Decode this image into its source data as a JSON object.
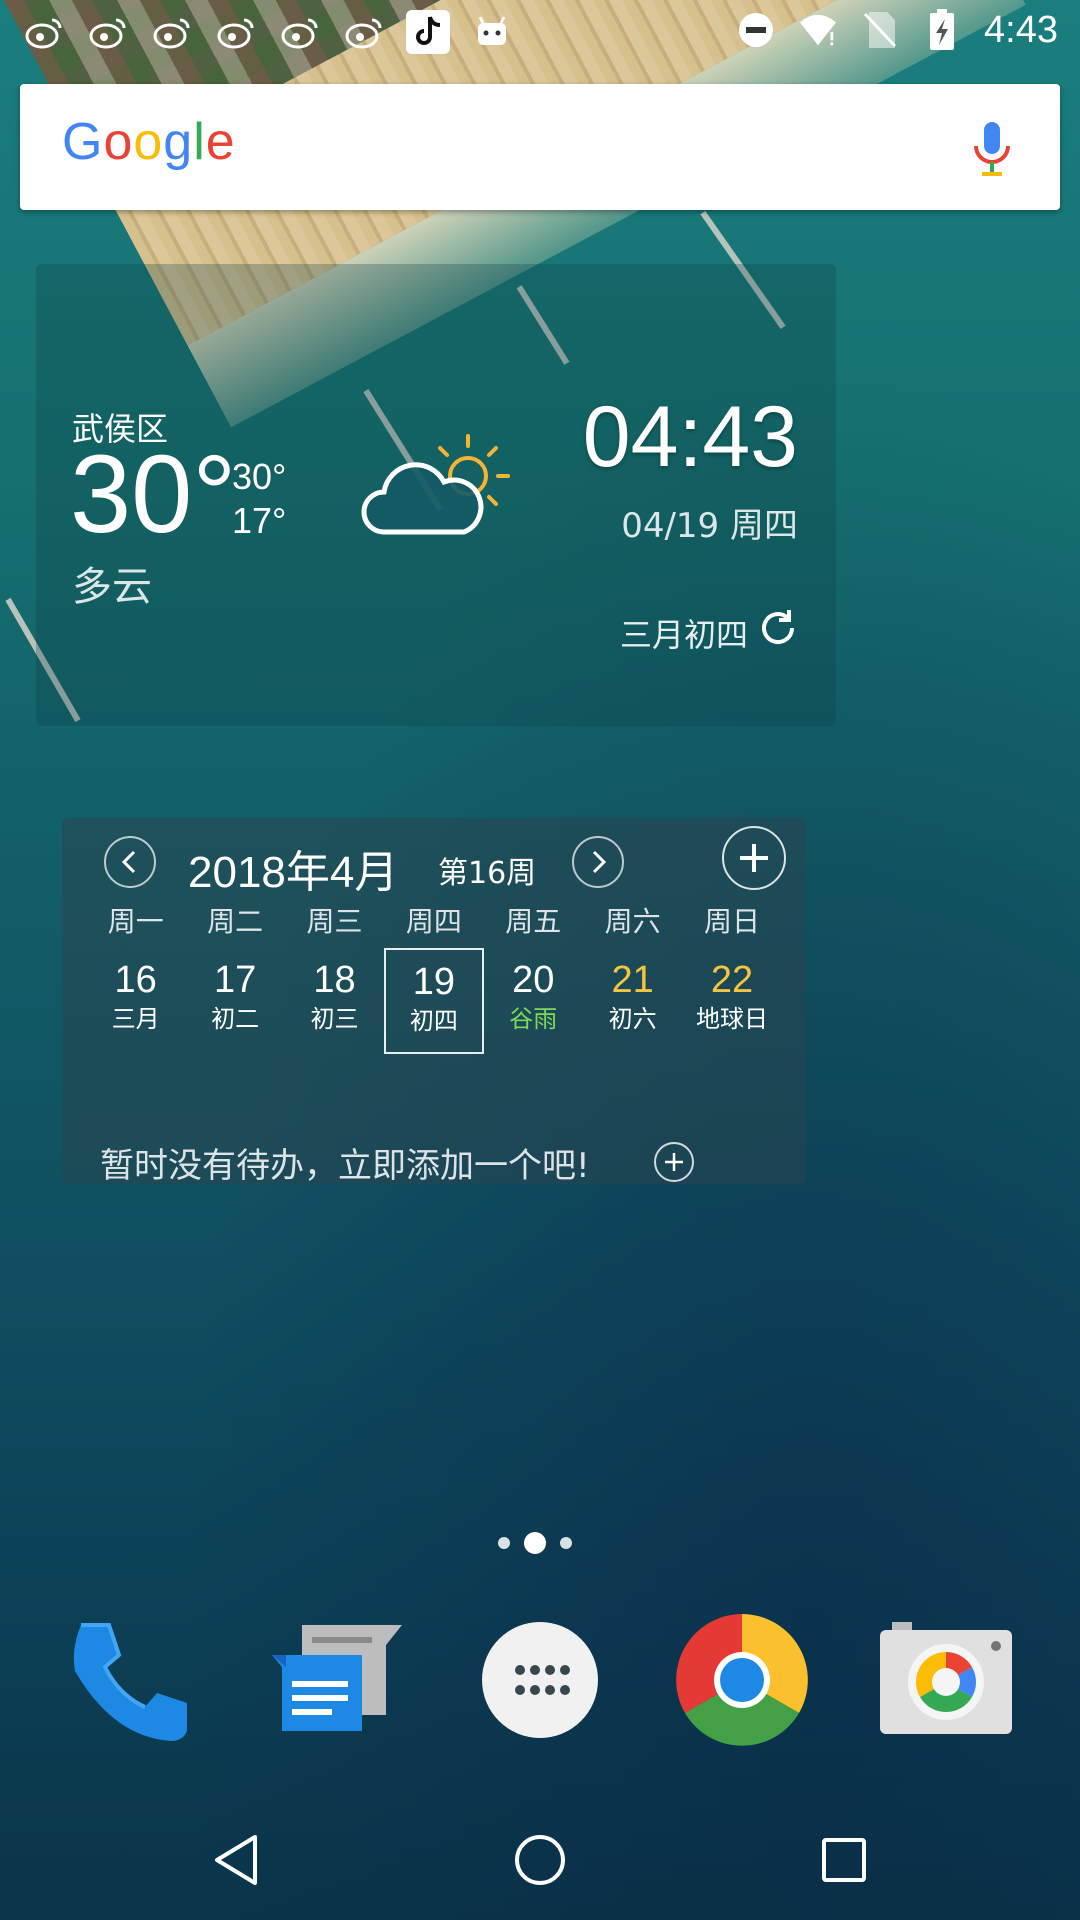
{
  "status_bar": {
    "notification_icons": [
      "weibo-icon",
      "weibo-icon",
      "weibo-icon",
      "weibo-icon",
      "weibo-icon",
      "weibo-icon",
      "douyin-icon",
      "android-icon"
    ],
    "system_icons": [
      "do-not-disturb-icon",
      "wifi-icon",
      "no-sim-icon",
      "battery-charging-icon"
    ],
    "time": "4:43"
  },
  "search": {
    "logo": "Google",
    "logo_colors": [
      "#4285F4",
      "#EA4335",
      "#FBBC05",
      "#4285F4",
      "#34A853",
      "#EA4335"
    ]
  },
  "weather": {
    "district": "武侯区",
    "temperature": "30°",
    "high": "30°",
    "low": "17°",
    "condition": "多云",
    "condition_icon": "partly-cloudy-icon",
    "time": "04:43",
    "date": "04/19  周四",
    "lunar_date": "三月初四"
  },
  "calendar": {
    "month_title": "2018年4月",
    "week_label": "第16周",
    "weekdays": [
      "周一",
      "周二",
      "周三",
      "周四",
      "周五",
      "周六",
      "周日"
    ],
    "days": [
      {
        "num": "16",
        "lunar": "三月"
      },
      {
        "num": "17",
        "lunar": "初二"
      },
      {
        "num": "18",
        "lunar": "初三"
      },
      {
        "num": "19",
        "lunar": "初四"
      },
      {
        "num": "20",
        "lunar": "谷雨"
      },
      {
        "num": "21",
        "lunar": "初六"
      },
      {
        "num": "22",
        "lunar": "地球日"
      }
    ],
    "selected_day": "19",
    "empty_message": "暂时没有待办，立即添加一个吧!",
    "weekend_color": "#F5C542",
    "solar_term_color": "#7ED957"
  },
  "home": {
    "page_count": 3,
    "active_page": 2
  },
  "dock": {
    "apps": [
      "phone-app-icon",
      "messages-app-icon",
      "app-drawer-icon",
      "chrome-app-icon",
      "camera-app-icon"
    ]
  },
  "navigation": {
    "buttons": [
      "back-icon",
      "home-icon",
      "recents-icon"
    ]
  }
}
